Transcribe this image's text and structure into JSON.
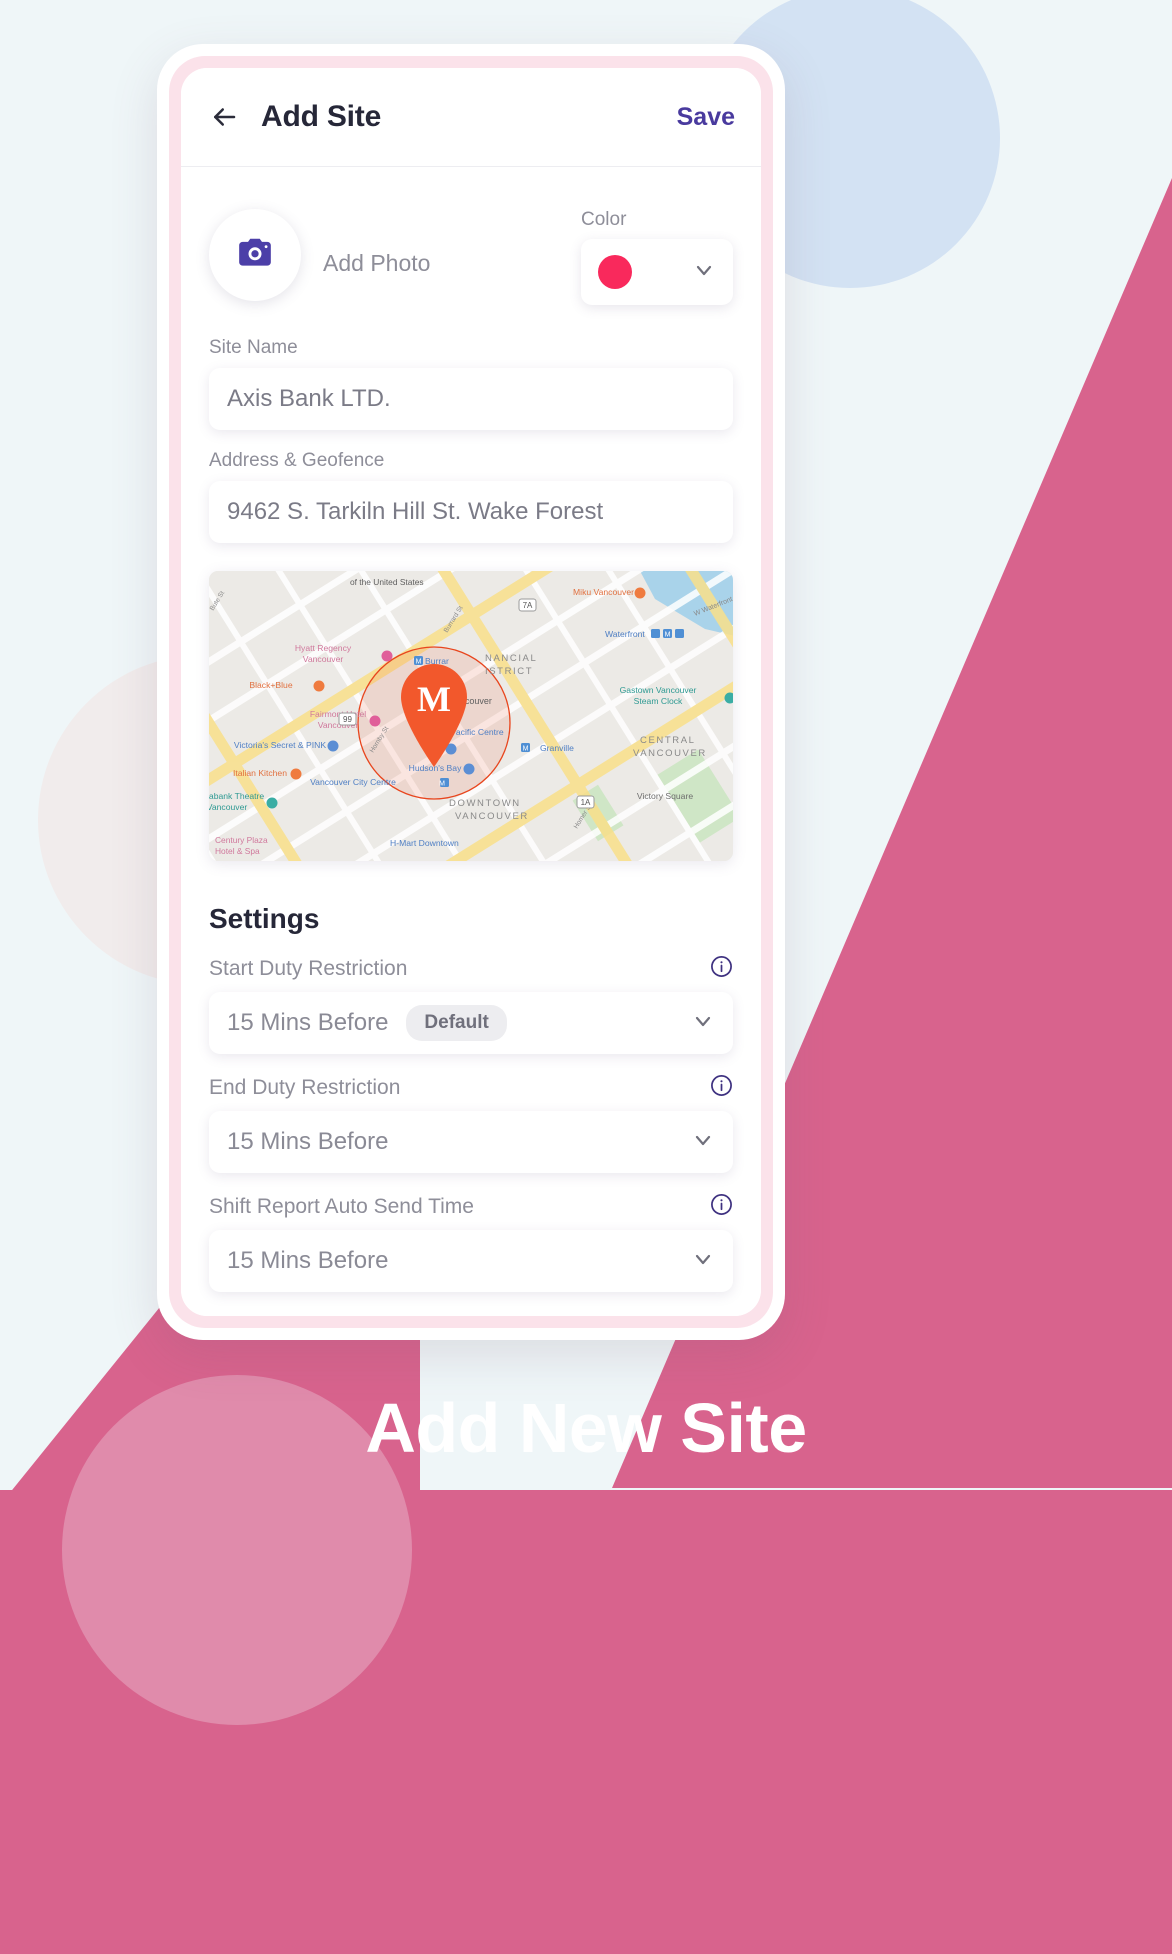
{
  "theme": {
    "page_background": "#eff6f8",
    "accent_pink": "#d8638d",
    "accent_indigo": "#493a9e",
    "swatch_color": "#f9295c",
    "blue_circle": "#d3e2f3"
  },
  "appbar": {
    "back_icon": "arrow-left-icon",
    "title": "Add Site",
    "save_label": "Save"
  },
  "photo": {
    "icon": "camera-icon",
    "label": "Add Photo"
  },
  "color": {
    "label": "Color",
    "value": "#f9295c",
    "chevron_icon": "chevron-down-icon"
  },
  "fields": [
    {
      "label": "Site Name",
      "value": "Axis Bank LTD.",
      "placeholder": "Site Name"
    },
    {
      "label": "Address & Geofence",
      "value": "9462 S. Tarkiln Hill St. Wake Forest",
      "placeholder": "Address & Geofence"
    }
  ],
  "map": {
    "marker_letter": "M",
    "marker_color": "#f2582c",
    "geofence_color": "#f2582c",
    "labels": [
      "of the United States",
      "Bute St",
      "Burrard St",
      "Hornby St",
      "Homer St",
      "W Waterfront Rd",
      "Hyatt Regency Vancouver",
      "Black+Blue",
      "Fairmont Hotel Vancouver",
      "Victoria's Secret & PINK",
      "Italian Kitchen",
      "Scotiabank Theatre Vancouver",
      "Century Plaza Hotel & Spa",
      "H-Mart Downtown",
      "Vancouver City Centre",
      "Hudson's Bay",
      "CF Pacific Centre",
      "Granville",
      "Burrard",
      "Miku Vancouver",
      "Waterfront",
      "Gastown Vancouver Steam Clock",
      "Victory Square",
      "ght Centre Vancouver",
      "FINANCIAL DISTRICT",
      "CENTRAL VANCOUVER",
      "DOWNTOWN VANCOUVER"
    ],
    "shields": [
      "7A",
      "99",
      "1A"
    ]
  },
  "settings": {
    "title": "Settings",
    "rows": [
      {
        "label": "Start Duty Restriction",
        "value": "15 Mins Before",
        "badge": "Default",
        "info_icon": "info-icon",
        "chevron_icon": "chevron-down-icon"
      },
      {
        "label": "End Duty Restriction",
        "value": "15 Mins Before",
        "badge": "",
        "info_icon": "info-icon",
        "chevron_icon": "chevron-down-icon"
      },
      {
        "label": "Shift Report Auto Send Time",
        "value": "15 Mins Before",
        "badge": "",
        "info_icon": "info-icon",
        "chevron_icon": "chevron-down-icon"
      }
    ]
  },
  "caption": {
    "text": "Add New Site"
  }
}
